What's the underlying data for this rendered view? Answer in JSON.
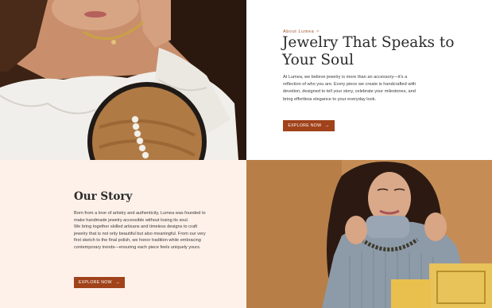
{
  "about": {
    "eyebrow": "About Lumea ✧",
    "headline": "Jewelry That Speaks to Your Soul",
    "body": "At Lumea, we believe jewelry is more than an accessory—it's a reflection of who you are. Every piece we create is handcrafted with devotion, designed to tell your story, celebrate your milestones, and bring effortless elegance to your everyday look.",
    "cta_label": "EXPLORE NOW",
    "cta_arrow": "→"
  },
  "story": {
    "title": "Our Story",
    "para1": "Born from a love of artistry and authenticity, Lumea was founded to make handmade jewelry accessible without losing its soul.",
    "para2": "We bring together skilled artisans and timeless designs to craft jewelry that is not only beautiful but also meaningful. From our very first sketch to the final polish, we honor tradition while embracing contemporary trends—ensuring each piece feels uniquely yours.",
    "cta_label": "EXPLORE NOW",
    "cta_arrow": "→"
  },
  "colors": {
    "accent": "#a0421a",
    "story_bg": "#fdf1ea",
    "eyebrow": "#a0522d"
  }
}
